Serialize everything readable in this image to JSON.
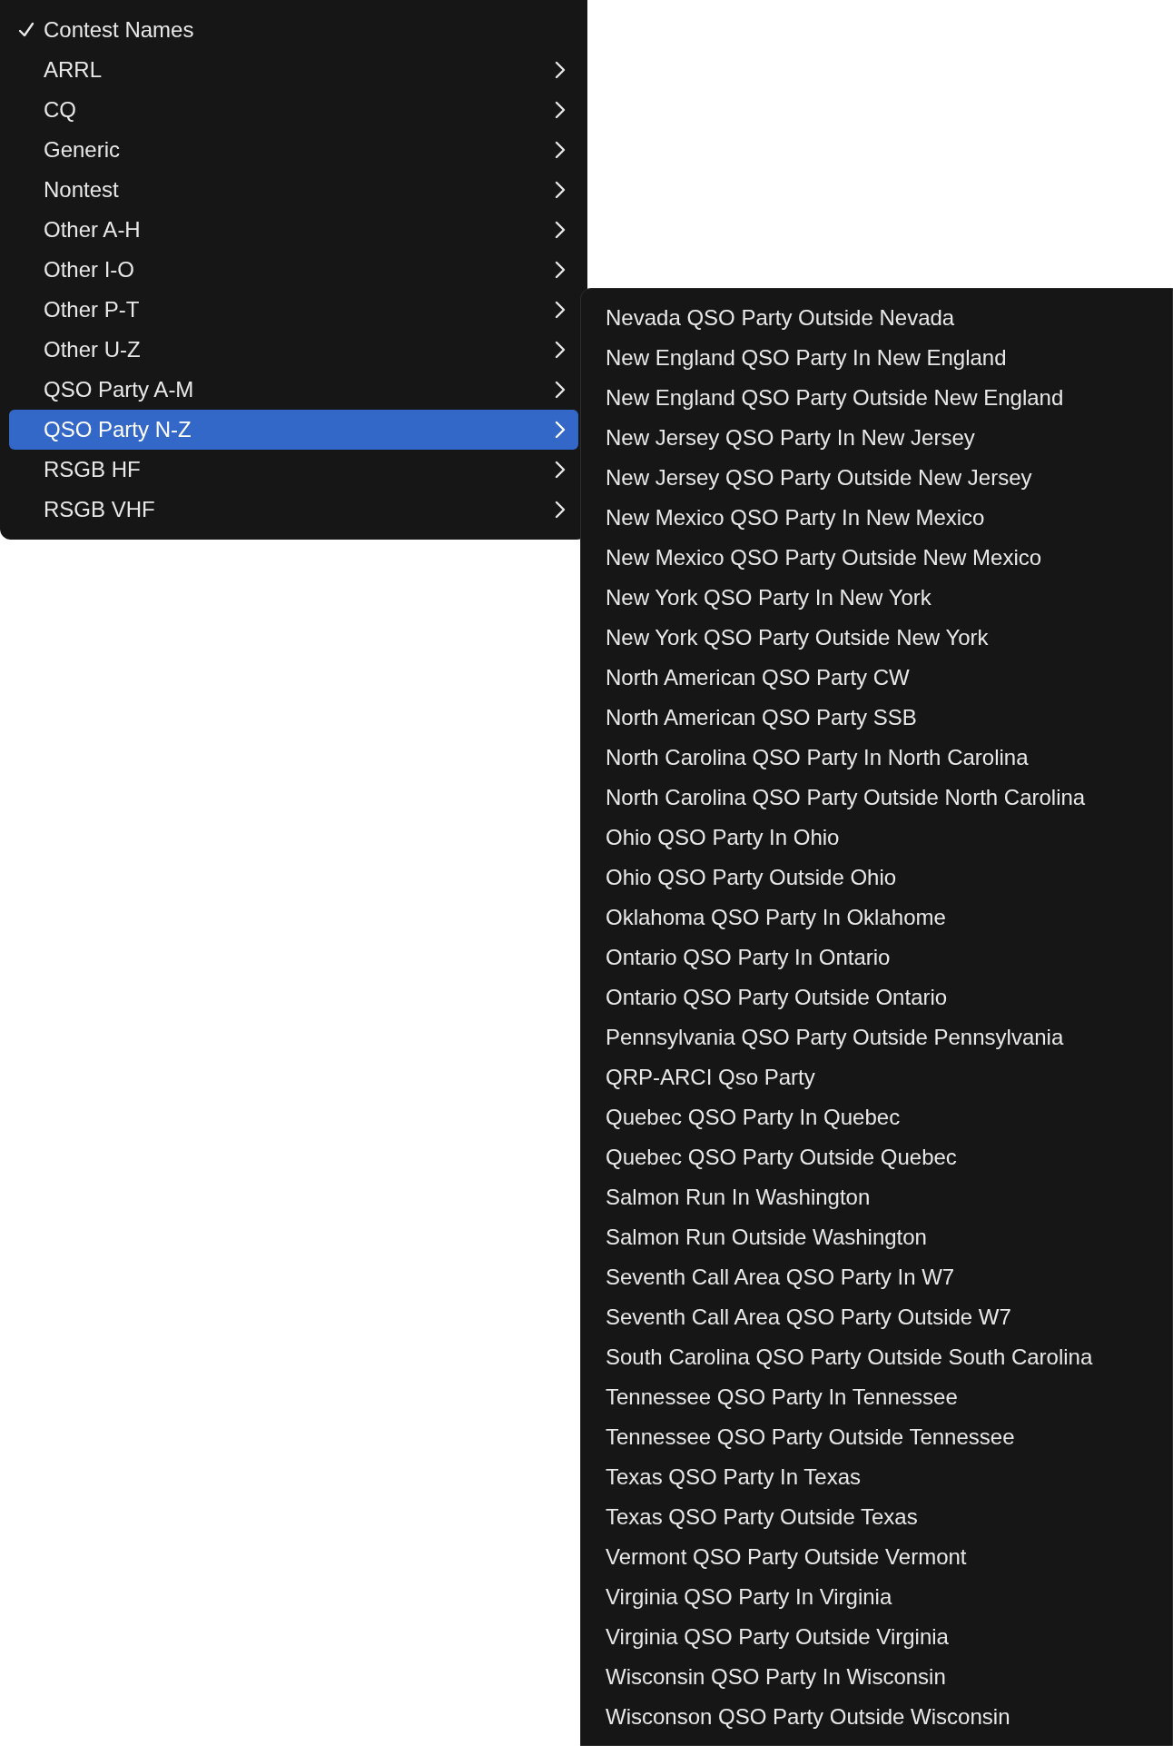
{
  "menu": {
    "header": {
      "label": "Contest Names",
      "checked": true
    },
    "items": [
      {
        "label": "ARRL",
        "selected": false,
        "has_submenu": true
      },
      {
        "label": "CQ",
        "selected": false,
        "has_submenu": true
      },
      {
        "label": "Generic",
        "selected": false,
        "has_submenu": true
      },
      {
        "label": "Nontest",
        "selected": false,
        "has_submenu": true
      },
      {
        "label": "Other A-H",
        "selected": false,
        "has_submenu": true
      },
      {
        "label": "Other I-O",
        "selected": false,
        "has_submenu": true
      },
      {
        "label": "Other P-T",
        "selected": false,
        "has_submenu": true
      },
      {
        "label": "Other U-Z",
        "selected": false,
        "has_submenu": true
      },
      {
        "label": "QSO Party A-M",
        "selected": false,
        "has_submenu": true
      },
      {
        "label": "QSO Party N-Z",
        "selected": true,
        "has_submenu": true
      },
      {
        "label": "RSGB HF",
        "selected": false,
        "has_submenu": true
      },
      {
        "label": "RSGB VHF",
        "selected": false,
        "has_submenu": true
      }
    ]
  },
  "submenu": {
    "items": [
      {
        "label": "Nevada QSO Party Outside Nevada"
      },
      {
        "label": "New England QSO Party In New England"
      },
      {
        "label": "New England QSO Party Outside New England"
      },
      {
        "label": "New Jersey QSO Party In New Jersey"
      },
      {
        "label": "New Jersey QSO Party Outside New Jersey"
      },
      {
        "label": "New Mexico QSO Party In New Mexico"
      },
      {
        "label": "New Mexico QSO Party Outside New Mexico"
      },
      {
        "label": "New York QSO Party In New York"
      },
      {
        "label": "New York QSO Party Outside New York"
      },
      {
        "label": "North American QSO Party CW"
      },
      {
        "label": "North American QSO Party SSB"
      },
      {
        "label": "North Carolina QSO Party In North Carolina"
      },
      {
        "label": "North Carolina QSO Party Outside North Carolina"
      },
      {
        "label": "Ohio QSO Party In Ohio"
      },
      {
        "label": "Ohio QSO Party Outside Ohio"
      },
      {
        "label": "Oklahoma QSO Party In Oklahome"
      },
      {
        "label": "Ontario QSO Party In Ontario"
      },
      {
        "label": "Ontario QSO Party Outside Ontario"
      },
      {
        "label": "Pennsylvania QSO Party Outside Pennsylvania"
      },
      {
        "label": "QRP-ARCI Qso Party"
      },
      {
        "label": "Quebec QSO Party In Quebec"
      },
      {
        "label": "Quebec QSO Party Outside Quebec"
      },
      {
        "label": "Salmon Run In Washington"
      },
      {
        "label": "Salmon Run Outside Washington"
      },
      {
        "label": "Seventh Call Area QSO Party In W7"
      },
      {
        "label": "Seventh Call Area QSO Party Outside W7"
      },
      {
        "label": "South Carolina QSO Party Outside South Carolina"
      },
      {
        "label": "Tennessee QSO Party In Tennessee"
      },
      {
        "label": "Tennessee QSO Party Outside Tennessee"
      },
      {
        "label": "Texas QSO Party In Texas"
      },
      {
        "label": "Texas QSO Party Outside Texas"
      },
      {
        "label": "Vermont QSO Party Outside Vermont"
      },
      {
        "label": "Virginia QSO Party In Virginia"
      },
      {
        "label": "Virginia QSO Party Outside Virginia"
      },
      {
        "label": "Wisconsin QSO Party In Wisconsin"
      },
      {
        "label": "Wisconson QSO Party Outside Wisconsin"
      }
    ]
  }
}
